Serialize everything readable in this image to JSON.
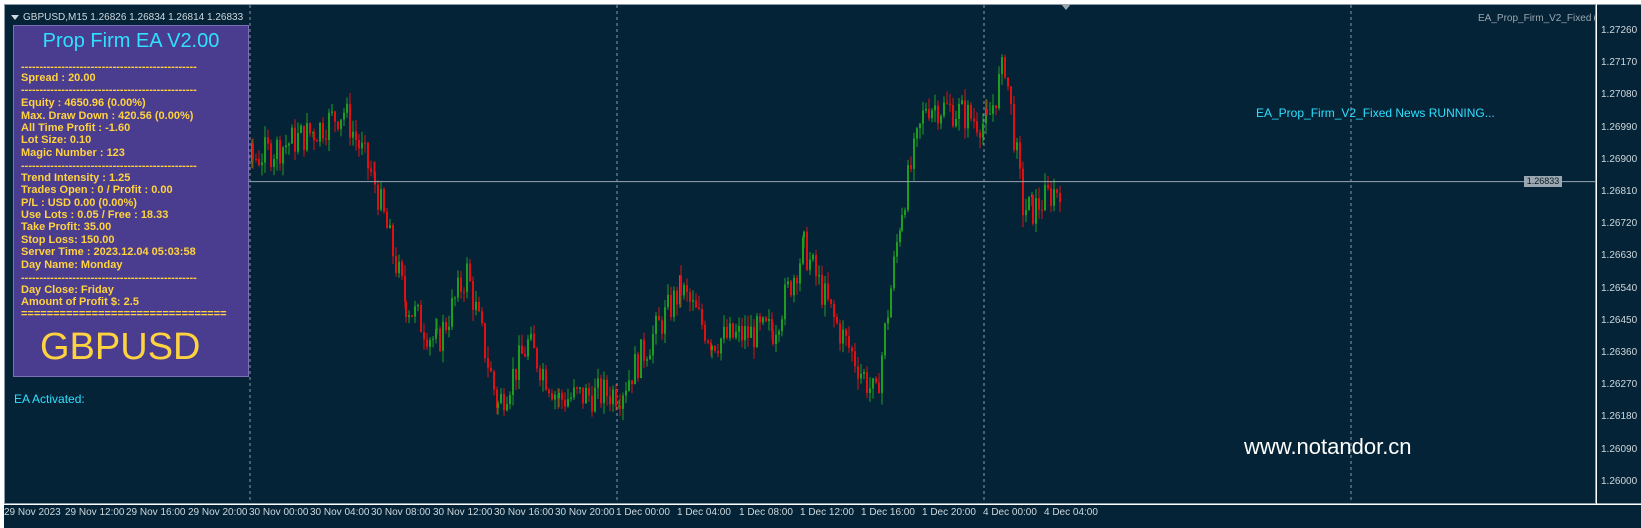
{
  "window": {
    "symbol_line": "GBPUSD,M15  1.26826 1.26834 1.26814 1.26833",
    "ea_name": "EA_Prop_Firm_V2_Fixed"
  },
  "panel": {
    "title": "Prop Firm EA V2.00",
    "lines": [
      "------------------------------------------------",
      "Spread : 20.00",
      "------------------------------------------------",
      "Equity : 4650.96 (0.00%)",
      "Max. Draw Down : 420.56 (0.00%)",
      "All Time Profit : -1.60",
      "Lot Size: 0.10",
      "Magic Number : 123",
      "------------------------------------------------",
      "Trend Intensity : 1.25",
      "Trades Open : 0 / Profit : 0.00",
      "P/L : USD 0.00 (0.00%)",
      "Use Lots : 0.05 / Free : 18.33",
      "Take Profit: 35.00",
      "Stop Loss: 150.00",
      "Server Time : 2023.12.04 05:03:58",
      "Day Name: Monday",
      "------------------------------------------------",
      "Day Close: Friday",
      "Amount of Profit $: 2.5",
      "================================"
    ],
    "symbol": "GBPUSD"
  },
  "ea_activated": "EA Activated:",
  "news_status": "EA_Prop_Firm_V2_Fixed News RUNNING...",
  "watermark": "www.notandor.cn",
  "price_axis": {
    "labels": [
      "1.27260",
      "1.27170",
      "1.27080",
      "1.26990",
      "1.26900",
      "1.26810",
      "1.26720",
      "1.26630",
      "1.26540",
      "1.26450",
      "1.26360",
      "1.26270",
      "1.26180",
      "1.26090",
      "1.26000"
    ],
    "current_price": "1.26833"
  },
  "time_axis": {
    "labels": [
      "29 Nov 2023",
      "29 Nov 12:00",
      "29 Nov 16:00",
      "29 Nov 20:00",
      "30 Nov 00:00",
      "30 Nov 04:00",
      "30 Nov 08:00",
      "30 Nov 12:00",
      "30 Nov 16:00",
      "30 Nov 20:00",
      "1 Dec 00:00",
      "1 Dec 04:00",
      "1 Dec 08:00",
      "1 Dec 12:00",
      "1 Dec 16:00",
      "1 Dec 20:00",
      "4 Dec 00:00",
      "4 Dec 04:00"
    ]
  },
  "colors": {
    "background": "#042337",
    "bull": "#1f9d1f",
    "bear": "#e01010",
    "grid": "#8a9aa6",
    "panel_bg": "#4a3d8f",
    "panel_text": "#ffd23f",
    "accent": "#2fe0ff"
  },
  "chart_data": {
    "type": "candlestick",
    "ylim": [
      1.2596,
      1.2729
    ],
    "close_path": [
      {
        "t": "29 Nov 20:00",
        "c": 1.2686
      },
      {
        "t": "30 Nov 00:00",
        "c": 1.269
      },
      {
        "t": "30 Nov 04:00",
        "c": 1.2698
      },
      {
        "t": "30 Nov 06:00",
        "c": 1.2704
      },
      {
        "t": "30 Nov 08:00",
        "c": 1.2683
      },
      {
        "t": "30 Nov 10:00",
        "c": 1.2648
      },
      {
        "t": "30 Nov 12:00",
        "c": 1.2636
      },
      {
        "t": "30 Nov 14:00",
        "c": 1.2657
      },
      {
        "t": "30 Nov 16:00",
        "c": 1.2618
      },
      {
        "t": "30 Nov 18:00",
        "c": 1.2636
      },
      {
        "t": "30 Nov 20:00",
        "c": 1.262
      },
      {
        "t": "1 Dec 00:00",
        "c": 1.2622
      },
      {
        "t": "1 Dec 04:00",
        "c": 1.2652
      },
      {
        "t": "1 Dec 06:00",
        "c": 1.2637
      },
      {
        "t": "1 Dec 10:00",
        "c": 1.264
      },
      {
        "t": "1 Dec 12:00",
        "c": 1.2664
      },
      {
        "t": "1 Dec 14:00",
        "c": 1.2643
      },
      {
        "t": "1 Dec 16:00",
        "c": 1.262
      },
      {
        "t": "1 Dec 18:00",
        "c": 1.2676
      },
      {
        "t": "1 Dec 20:00",
        "c": 1.2706
      },
      {
        "t": "1 Dec 22:00",
        "c": 1.2704
      },
      {
        "t": "4 Dec 00:00",
        "c": 1.27
      },
      {
        "t": "4 Dec 01:00",
        "c": 1.2718
      },
      {
        "t": "4 Dec 02:00",
        "c": 1.2676
      },
      {
        "t": "4 Dec 03:00",
        "c": 1.2675
      },
      {
        "t": "4 Dec 05:00",
        "c": 1.2683
      }
    ]
  }
}
